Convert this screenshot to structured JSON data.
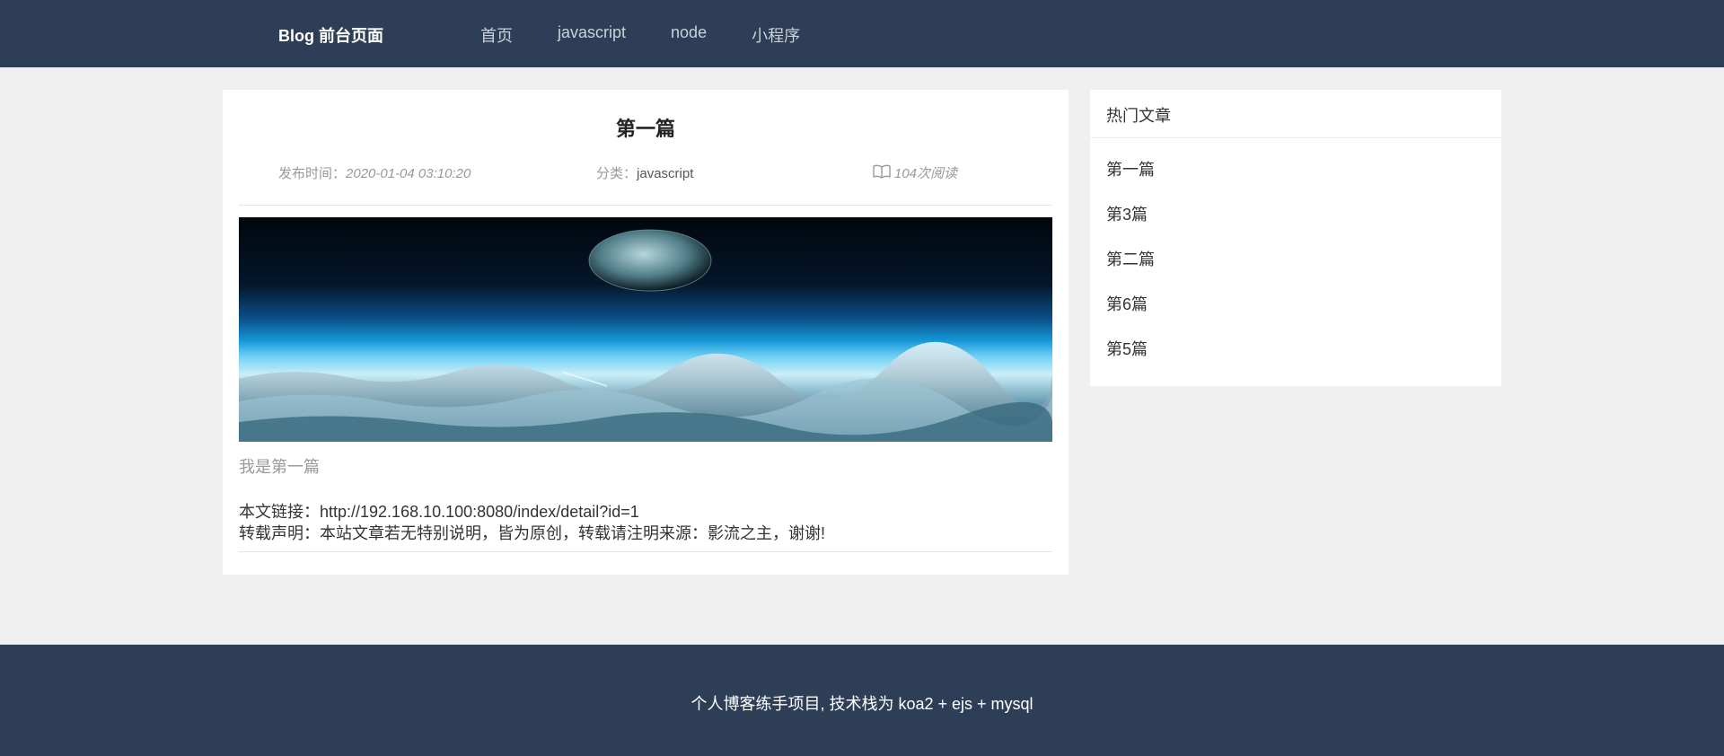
{
  "header": {
    "brand": "Blog 前台页面",
    "nav": [
      "首页",
      "javascript",
      "node",
      "小程序"
    ]
  },
  "article": {
    "title": "第一篇",
    "meta": {
      "date_label": "发布时间：",
      "date_value": "2020-01-04 03:10:20",
      "category_label": "分类：",
      "category_value": "javascript",
      "views": "104次阅读",
      "views_icon": "book-open-icon"
    },
    "summary": "我是第一篇",
    "link_label": "本文链接：",
    "link_url": "http://192.168.10.100:8080/index/detail?id=1",
    "notice_label": "转载声明：",
    "notice_text": "本站文章若无特别说明，皆为原创，转载请注明来源：影流之主，谢谢!"
  },
  "sidebar": {
    "title": "热门文章",
    "items": [
      "第一篇",
      "第3篇",
      "第二篇",
      "第6篇",
      "第5篇"
    ]
  },
  "footer": {
    "text": "个人博客练手项目, 技术栈为 koa2 + ejs + mysql"
  },
  "colors": {
    "header_bg": "#2e3e56",
    "page_bg": "#f0f0f0",
    "card_bg": "#ffffff"
  }
}
